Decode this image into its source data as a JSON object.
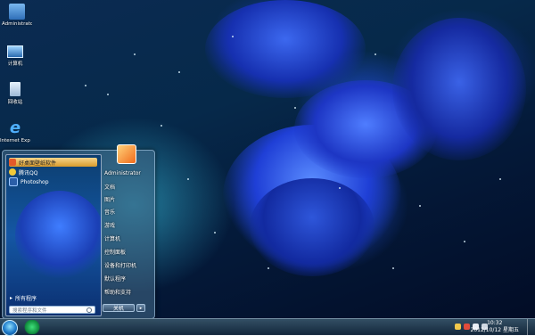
{
  "desktop_icons": [
    {
      "label": "Administrator",
      "icon": "user-folder-icon"
    },
    {
      "label": "计算机",
      "icon": "computer-icon"
    },
    {
      "label": "回收站",
      "icon": "recycle-bin-icon"
    },
    {
      "label": "Internet Explorer",
      "icon": "internet-explorer-icon"
    }
  ],
  "start_menu": {
    "pinned": [
      {
        "label": "好桌面壁纸软件",
        "icon": "wallpaper-app-icon"
      },
      {
        "label": "腾讯QQ",
        "icon": "qq-icon"
      },
      {
        "label": "Photoshop",
        "icon": "photoshop-icon"
      }
    ],
    "all_programs": "所有程序",
    "search_placeholder": "搜索程序和文件",
    "username": "Administrator",
    "right_items": [
      "文档",
      "图片",
      "音乐",
      "游戏",
      "计算机",
      "控制面板",
      "设备和打印机",
      "默认程序",
      "帮助和支持"
    ],
    "shutdown_label": "关机"
  },
  "taskbar": {
    "time": "10:32",
    "date": "2012/10/12 星期五"
  },
  "colors": {
    "highlight": "#f2c66d",
    "taskbar": "#2a4a62",
    "accent": "#1d7ac9"
  }
}
